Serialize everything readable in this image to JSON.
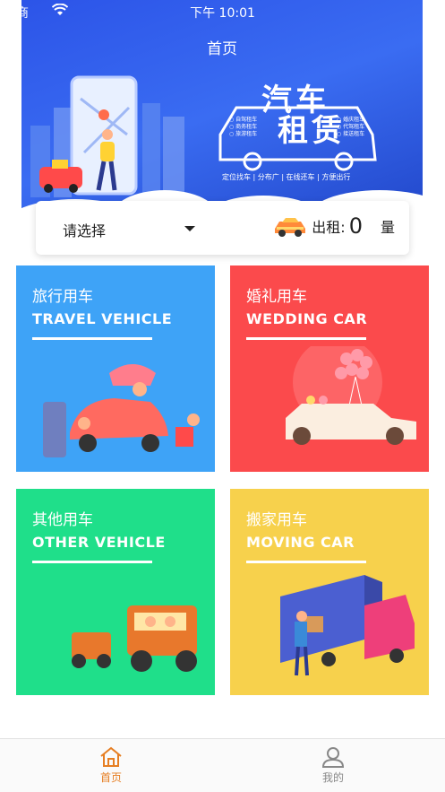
{
  "status_bar": {
    "carrier": "营商",
    "time": "下午 10:01"
  },
  "banner": {
    "title": "首页",
    "logo_line1": "汽车",
    "logo_line2": "租赁",
    "logo_left_list": [
      "○ 自驾租车",
      "○ 商务租车",
      "○ 旅游租车"
    ],
    "logo_right_list": [
      "○ 婚庆租车",
      "○ 代驾租车",
      "○ 接送租车"
    ],
    "slogan": "定位找车 | 分布广 | 在线还车 | 方便出行"
  },
  "filter": {
    "select_label": "请选择",
    "rent_label": "出租:",
    "rent_count": "0",
    "rent_unit": "量"
  },
  "tiles": [
    {
      "cn": "旅行用车",
      "en": "TRAVEL VEHICLE",
      "color": "#3ea3f7"
    },
    {
      "cn": "婚礼用车",
      "en": "WEDDING CAR",
      "color": "#fb4a4c"
    },
    {
      "cn": "其他用车",
      "en": "OTHER VEHICLE",
      "color": "#1fdf8a"
    },
    {
      "cn": "搬家用车",
      "en": "MOVING CAR",
      "color": "#f7d14c"
    }
  ],
  "tab_bar": {
    "home_label": "首页",
    "mine_label": "我的",
    "active_color": "#e67e22",
    "inactive_color": "#888888"
  }
}
